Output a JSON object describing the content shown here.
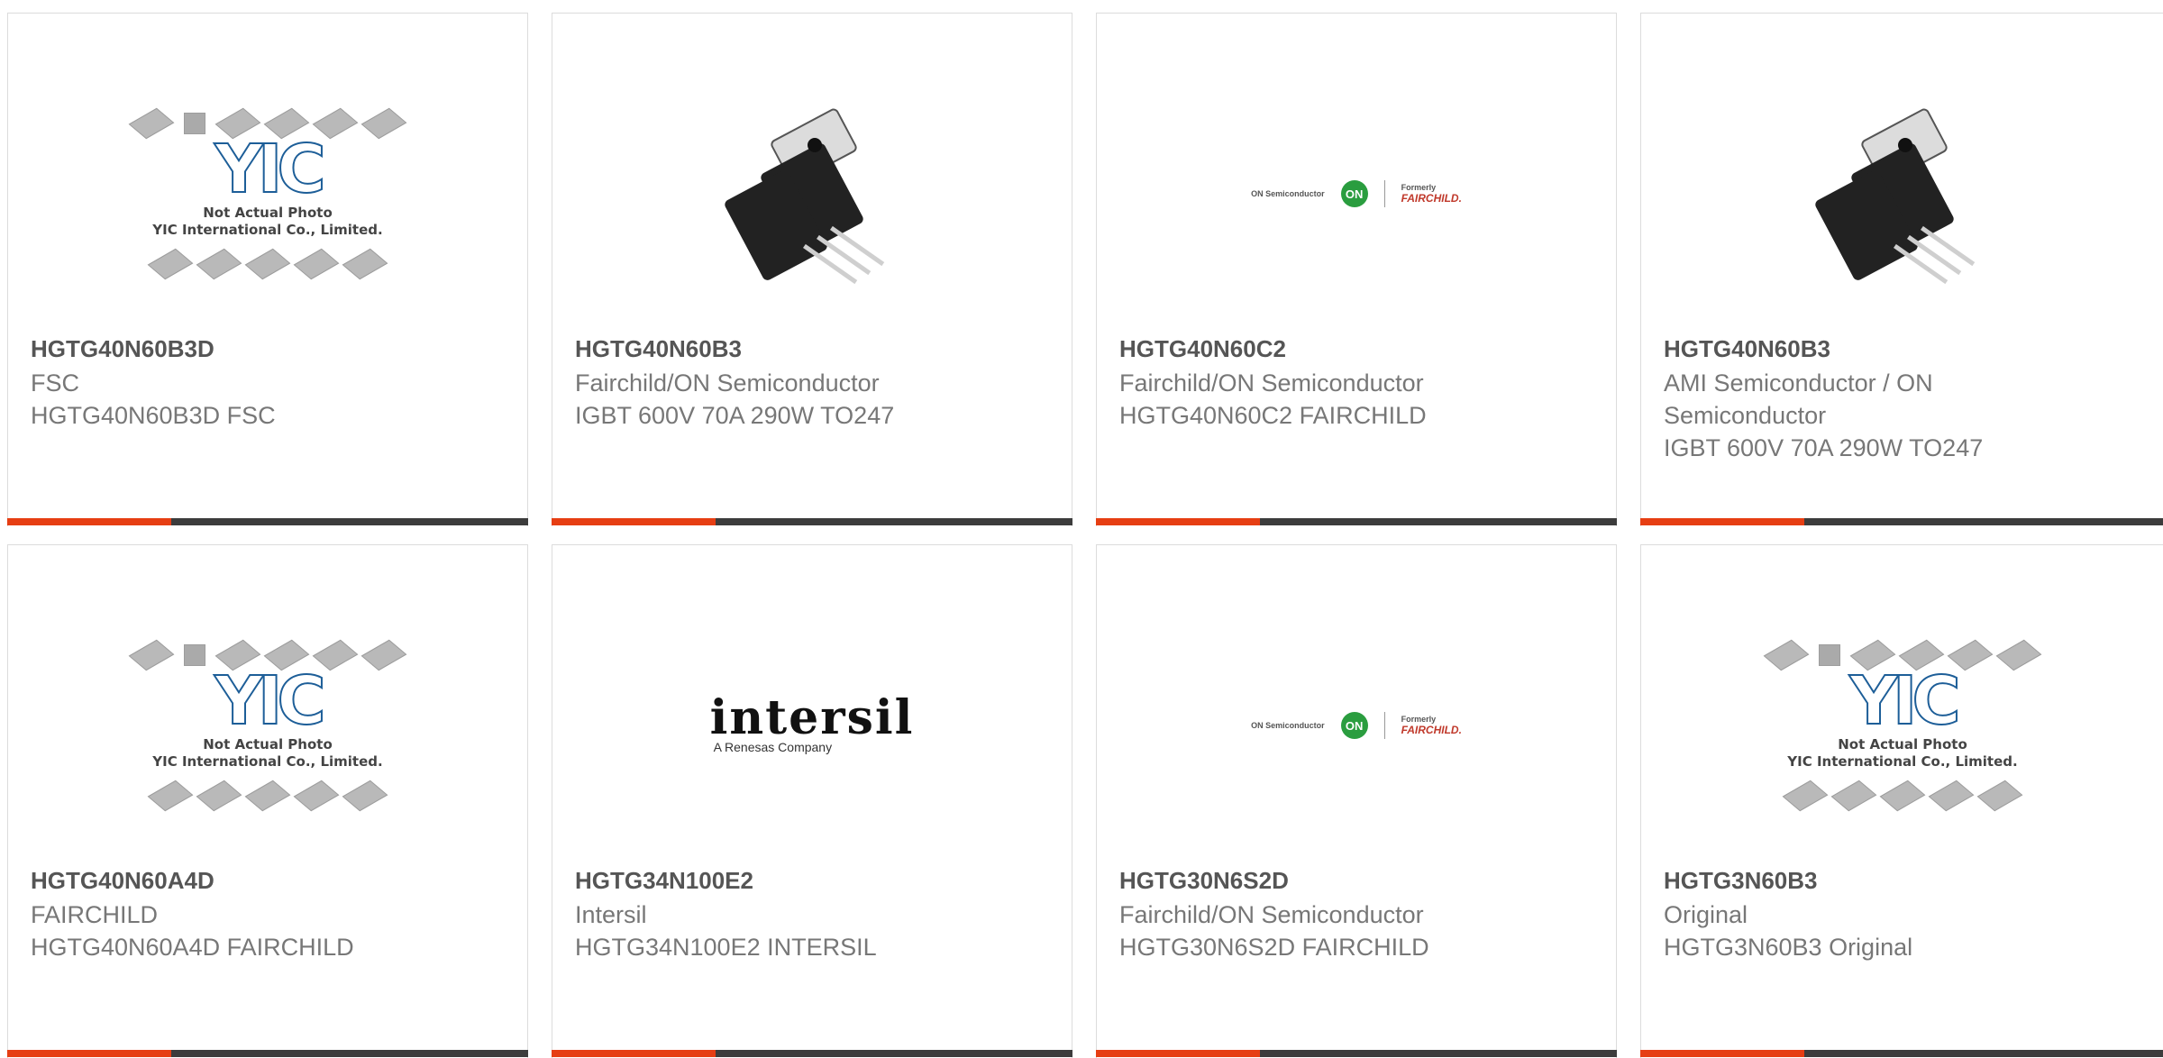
{
  "products": [
    {
      "part": "HGTG40N60B3D",
      "manufacturer": "FSC",
      "description": "HGTG40N60B3D FSC",
      "image": "yic-placeholder"
    },
    {
      "part": "HGTG40N60B3",
      "manufacturer": "Fairchild/ON Semiconductor",
      "description": "IGBT 600V 70A 290W TO247",
      "image": "to247-photo"
    },
    {
      "part": "HGTG40N60C2",
      "manufacturer": "Fairchild/ON Semiconductor",
      "description": "HGTG40N60C2 FAIRCHILD",
      "image": "on-fairchild-logo"
    },
    {
      "part": "HGTG40N60B3",
      "manufacturer": "AMI Semiconductor / ON Semiconductor",
      "description": "IGBT 600V 70A 290W TO247",
      "image": "to247-photo"
    },
    {
      "part": "HGTG40N60A4D",
      "manufacturer": "FAIRCHILD",
      "description": "HGTG40N60A4D FAIRCHILD",
      "image": "yic-placeholder"
    },
    {
      "part": "HGTG34N100E2",
      "manufacturer": "Intersil",
      "description": "HGTG34N100E2 INTERSIL",
      "image": "intersil-logo"
    },
    {
      "part": "HGTG30N6S2D",
      "manufacturer": "Fairchild/ON Semiconductor",
      "description": "HGTG30N6S2D FAIRCHILD",
      "image": "on-fairchild-logo"
    },
    {
      "part": "HGTG3N60B3",
      "manufacturer": "Original",
      "description": "HGTG3N60B3 Original",
      "image": "yic-placeholder"
    }
  ],
  "placeholder": {
    "logo_text": "YIC",
    "line1": "Not Actual Photo",
    "line2": "YIC International Co., Limited."
  },
  "on_fairchild": {
    "on_small": "ON Semiconductor",
    "on_mark": "ON",
    "formerly": "Formerly",
    "fairchild": "FAIRCHILD."
  },
  "intersil": {
    "word": "intersil",
    "sub": "A Renesas Company"
  },
  "colors": {
    "accent_red": "#e63e13",
    "bar_dark": "#3c3c3c",
    "part_text": "#555555",
    "meta_text": "#777777"
  }
}
